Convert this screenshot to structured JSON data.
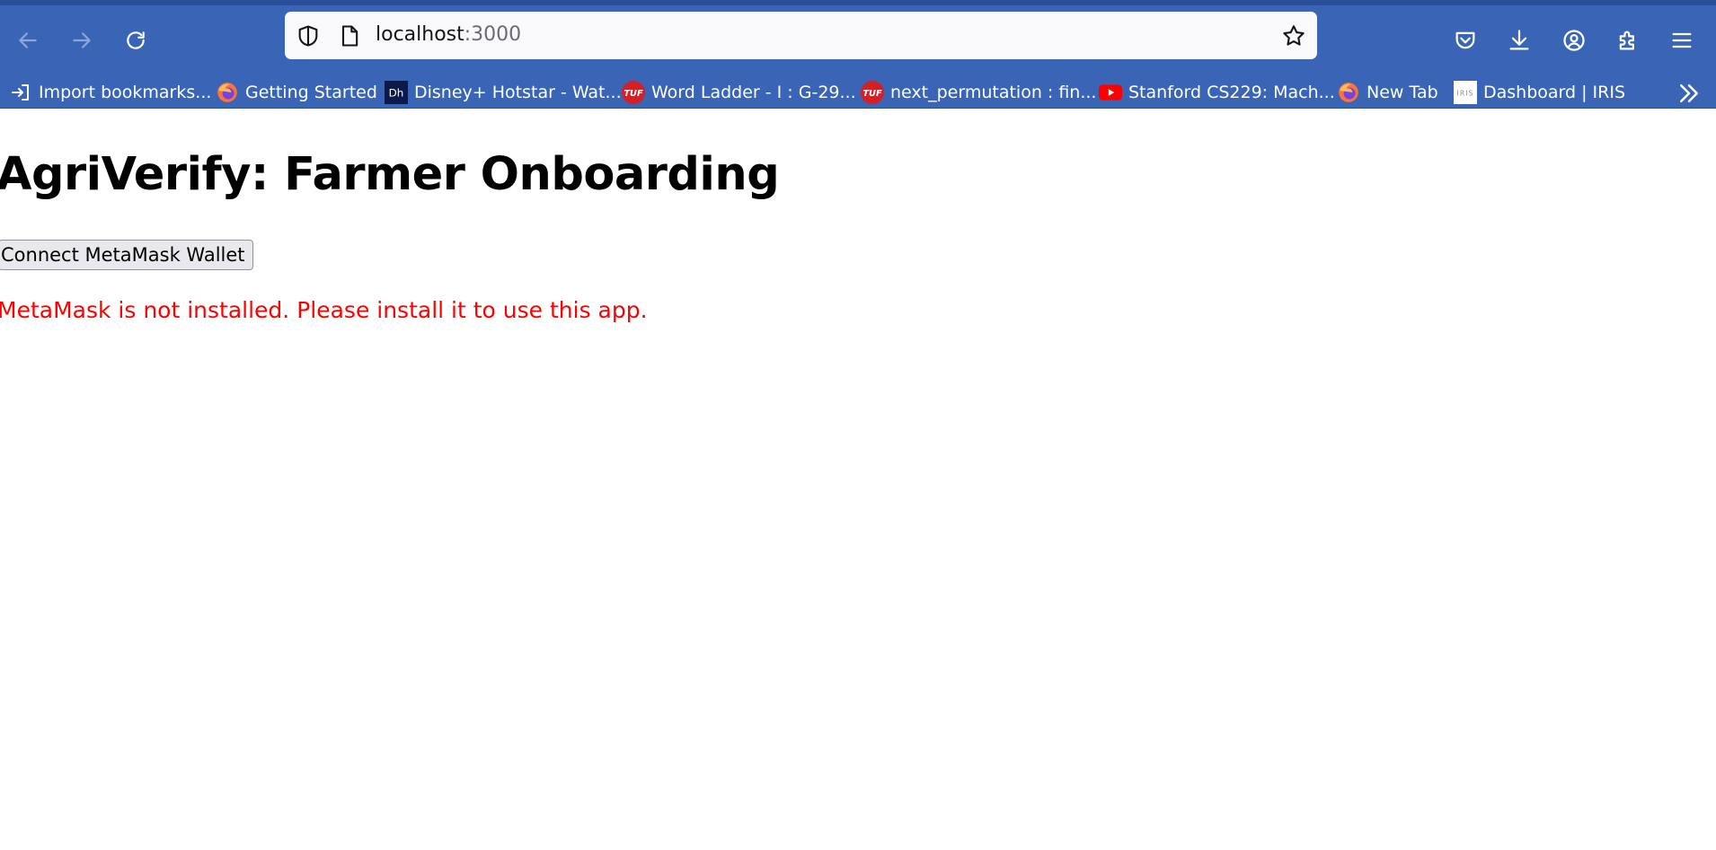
{
  "browser": {
    "url_host": "localhost",
    "url_port": ":3000",
    "bookmarks": [
      {
        "label": "Import bookmarks...",
        "icon": "import-icon"
      },
      {
        "label": "Getting Started",
        "icon": "firefox-icon"
      },
      {
        "label": "Disney+ Hotstar - Wat...",
        "icon": "hotstar-icon"
      },
      {
        "label": "Word Ladder - I : G-29...",
        "icon": "tuf-icon"
      },
      {
        "label": "next_permutation : fin...",
        "icon": "tuf-icon"
      },
      {
        "label": "Stanford CS229: Mach...",
        "icon": "youtube-icon"
      },
      {
        "label": "New Tab",
        "icon": "firefox-icon"
      },
      {
        "label": "Dashboard | IRIS",
        "icon": "iris-icon"
      }
    ],
    "hotstar_badge": "Dh",
    "tuf_badge": "TUF",
    "iris_badge": "IRIS",
    "colors": {
      "chrome": "#3a65b6",
      "urlbar": "#f9f9fb"
    }
  },
  "page": {
    "title": "AgriVerify: Farmer Onboarding",
    "connect_button": "Connect MetaMask Wallet",
    "error_message": "MetaMask is not installed. Please install it to use this app.",
    "error_color": "#ff0000"
  }
}
